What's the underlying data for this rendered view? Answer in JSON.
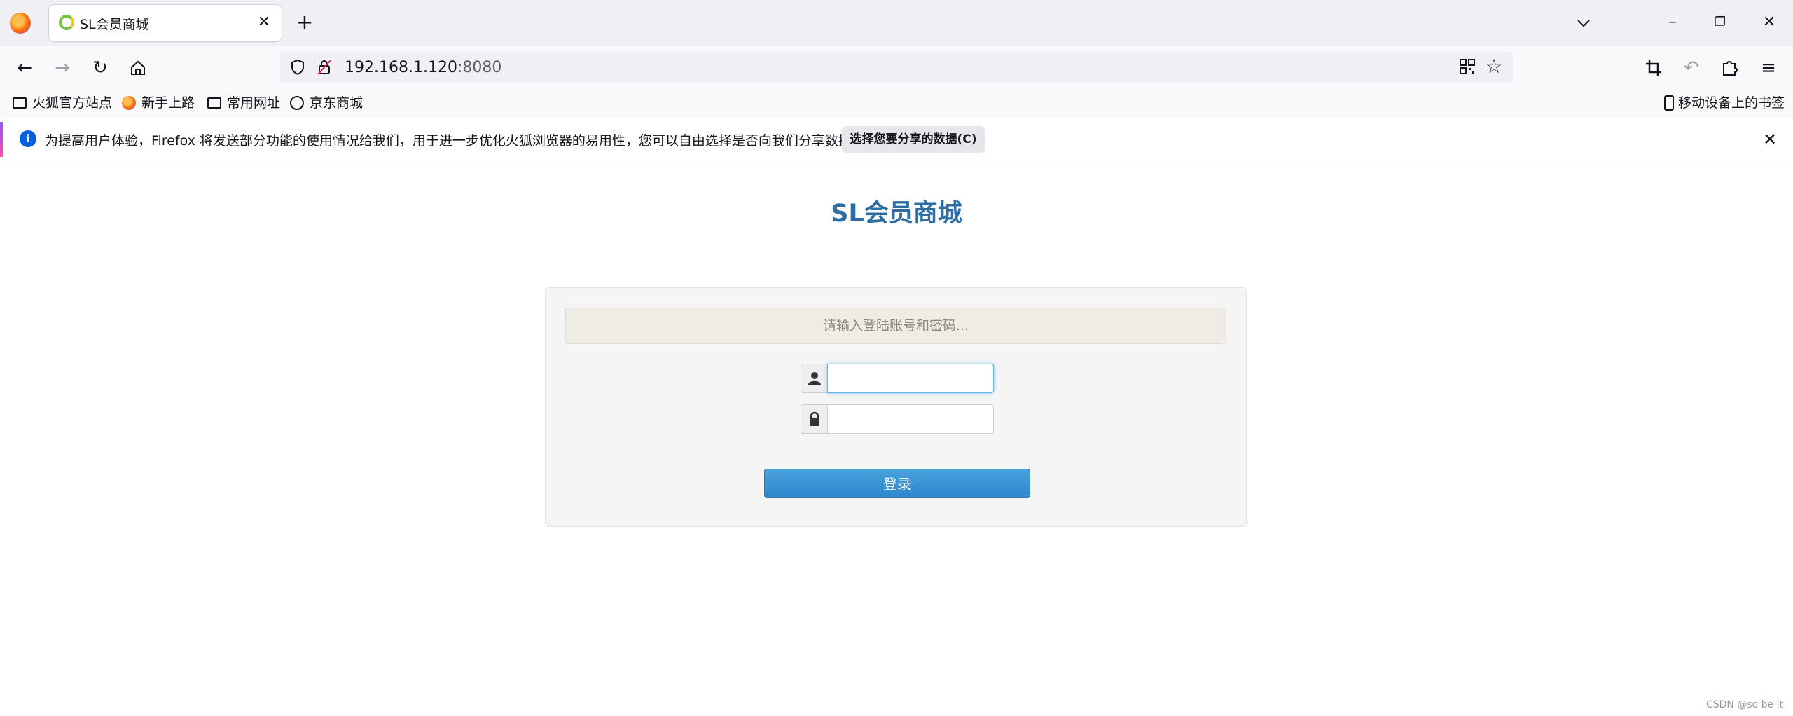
{
  "browser": {
    "tab": {
      "title": "SL会员商城"
    },
    "url": {
      "host": "192.168.1.120",
      "port": ":8080"
    },
    "bookmarks": [
      {
        "label": "火狐官方站点",
        "icon": "folder-icon"
      },
      {
        "label": "新手上路",
        "icon": "firefox-icon"
      },
      {
        "label": "常用网址",
        "icon": "folder-icon"
      },
      {
        "label": "京东商城",
        "icon": "globe-icon"
      }
    ],
    "mobile_bookmarks": "移动设备上的书签",
    "notification": {
      "text": "为提高用户体验，Firefox 将发送部分功能的使用情况给我们，用于进一步优化火狐浏览器的易用性，您可以自由选择是否向我们分享数据。",
      "button": "选择您要分享的数据(C)"
    }
  },
  "page": {
    "title": "SL会员商城",
    "hint": "请输入登陆账号和密码...",
    "username": {
      "value": "",
      "icon": "user-icon"
    },
    "password": {
      "value": "",
      "icon": "lock-icon"
    },
    "login_label": "登录"
  },
  "watermark": "CSDN @so be it",
  "colors": {
    "title": "#2e6da4",
    "button": "#3a95d5",
    "hint_bg": "#eeece4"
  }
}
